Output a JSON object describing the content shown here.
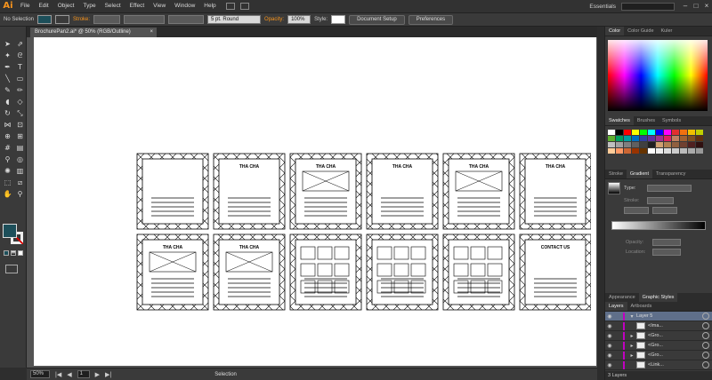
{
  "app": {
    "logo": "Ai",
    "menu": [
      "File",
      "Edit",
      "Object",
      "Type",
      "Select",
      "Effect",
      "View",
      "Window",
      "Help"
    ],
    "workspace": "Essentials",
    "window_controls": [
      "–",
      "□",
      "×"
    ]
  },
  "control_bar": {
    "selection_label": "No Selection",
    "stroke_label": "Stroke:",
    "brush_value": "5 pt. Round",
    "opacity_label": "Opacity:",
    "opacity_value": "100%",
    "style_label": "Style:",
    "document_setup": "Document Setup",
    "preferences": "Preferences"
  },
  "document": {
    "tab_title": "BrochurePan2.ai* @ 50% (RGB/Outline)",
    "close": "×"
  },
  "panels": {
    "color_tabs": [
      "Color",
      "Color Guide",
      "Kuler"
    ],
    "swatch_tabs": [
      "Swatches",
      "Brushes",
      "Symbols"
    ],
    "gradient_tabs": [
      "Stroke",
      "Gradient",
      "Transparency"
    ],
    "gradient_type_label": "Type:",
    "gradient_stroke_label": "Stroke:",
    "gradient_opacity_label": "Opacity:",
    "gradient_location_label": "Location:",
    "appearance_tabs": [
      "Appearance",
      "Graphic Styles"
    ],
    "layers_tabs": [
      "Layers",
      "Artboards"
    ],
    "layers": [
      {
        "name": "Layer 5",
        "indent": 0
      },
      {
        "name": "<Ima...",
        "indent": 1
      },
      {
        "name": "<Gro...",
        "indent": 1
      },
      {
        "name": "<Gro...",
        "indent": 1
      },
      {
        "name": "<Gro...",
        "indent": 1
      },
      {
        "name": "<Link...",
        "indent": 1
      }
    ],
    "layers_count": "3 Layers",
    "swatch_colors": [
      "#ffffff",
      "#000000",
      "#ff0000",
      "#ffff00",
      "#00ff00",
      "#00ffff",
      "#0000ff",
      "#ff00ff",
      "#e03030",
      "#f07010",
      "#f0c000",
      "#c0d000",
      "#60b030",
      "#00a060",
      "#00a0a0",
      "#0070c0",
      "#3040a0",
      "#6030a0",
      "#a03090",
      "#e02060",
      "#c08060",
      "#a06030",
      "#805020",
      "#603010",
      "#c0c0c0",
      "#a0a0a0",
      "#808080",
      "#606060",
      "#404040",
      "#202020",
      "#d0a070",
      "#b08050",
      "#906040",
      "#704030",
      "#502020",
      "#301010",
      "#ffcc99",
      "#ff9966",
      "#cc6633",
      "#993300",
      "#663300",
      "#ffffff",
      "#eeeeee",
      "#dddddd",
      "#cccccc",
      "#bbbbbb",
      "#aaaaaa",
      "#999999"
    ]
  },
  "status_bar": {
    "zoom": "50%",
    "page": "1",
    "tool": "Selection"
  },
  "artwork": {
    "panel_headings": [
      "THA CHA",
      "THA CHA",
      "THA CHA",
      "THA CHA",
      "THA CHA",
      "THA CHA",
      "THA CHA",
      "CONTACT US"
    ]
  }
}
